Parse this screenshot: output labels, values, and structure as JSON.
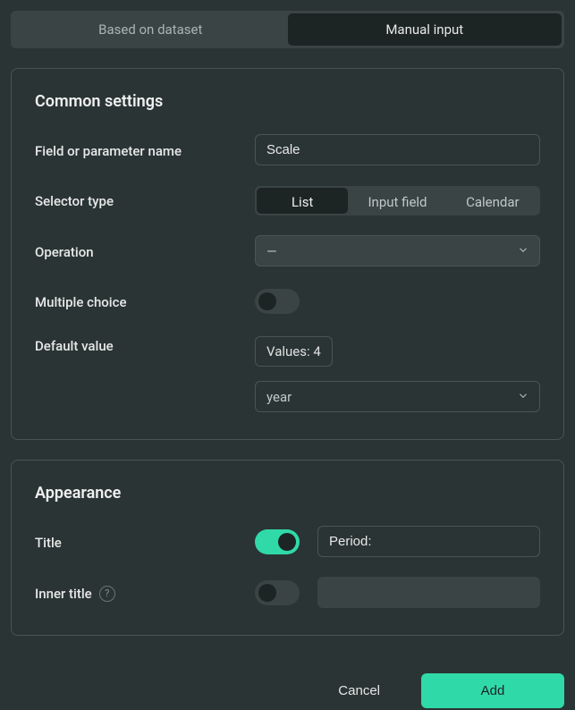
{
  "tabs": {
    "dataset": "Based on dataset",
    "manual": "Manual input"
  },
  "common": {
    "title": "Common settings",
    "field_name_label": "Field or parameter name",
    "field_name_value": "Scale",
    "selector_type_label": "Selector type",
    "selector_types": {
      "list": "List",
      "input": "Input field",
      "calendar": "Calendar"
    },
    "operation_label": "Operation",
    "operation_value": "—",
    "multiple_label": "Multiple choice",
    "default_label": "Default value",
    "default_chip": "Values: 4",
    "default_select": "year"
  },
  "appearance": {
    "title": "Appearance",
    "title_label": "Title",
    "title_value": "Period:",
    "inner_title_label": "Inner title",
    "inner_title_value": ""
  },
  "footer": {
    "cancel": "Cancel",
    "add": "Add"
  }
}
